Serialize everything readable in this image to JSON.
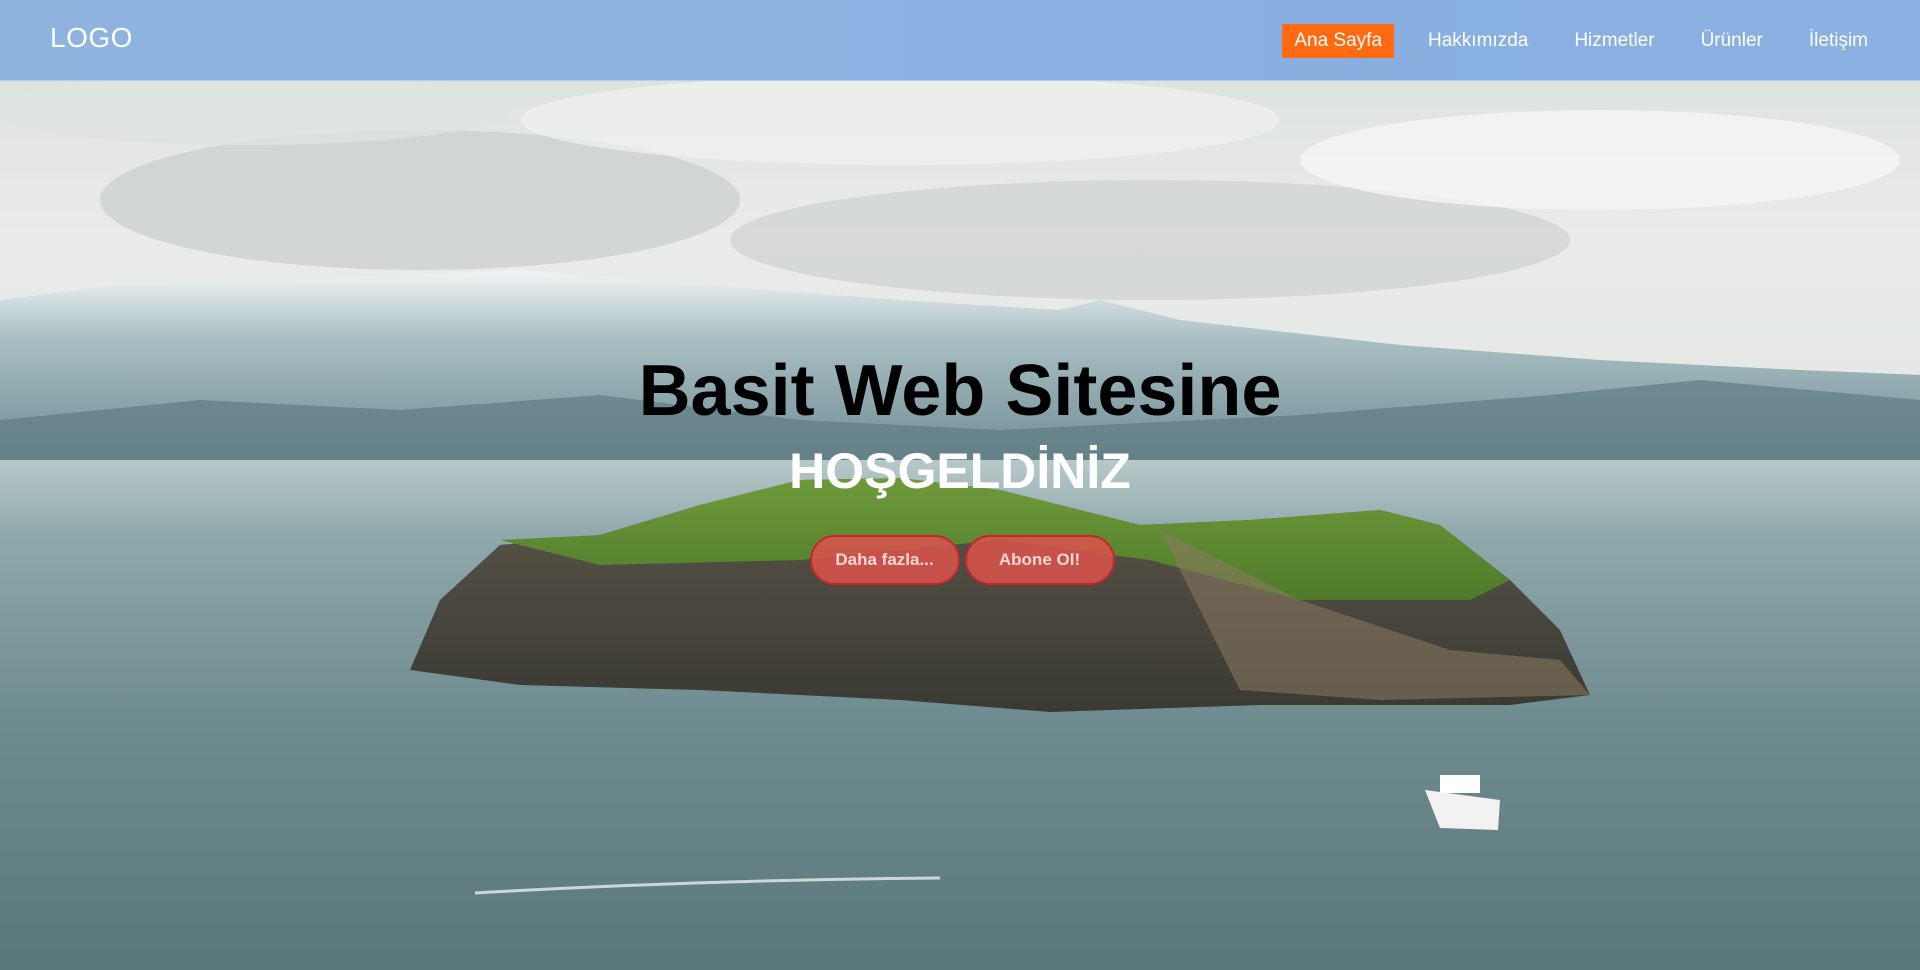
{
  "header": {
    "logo": "LOGO",
    "nav": [
      {
        "label": "Ana Sayfa",
        "active": true
      },
      {
        "label": "Hakkımızda",
        "active": false
      },
      {
        "label": "Hizmetler",
        "active": false
      },
      {
        "label": "Ürünler",
        "active": false
      },
      {
        "label": "İletişim",
        "active": false
      }
    ],
    "active_color": "#ff6a13"
  },
  "hero": {
    "title": "Basit Web Sitesine",
    "subtitle": "HOŞGELDİNİZ",
    "buttons": [
      {
        "label": "Daha fazla..."
      },
      {
        "label": "Abone Ol!"
      }
    ],
    "button_color": "#d7534b"
  }
}
